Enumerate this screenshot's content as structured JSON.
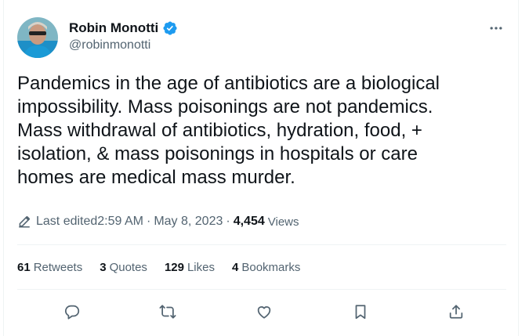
{
  "author": {
    "name": "Robin Monotti",
    "handle": "@robinmonotti",
    "verified": true
  },
  "tweet": {
    "text": "Pandemics in the age of antibiotics are a biological\nimpossibility. Mass poisonings are not pandemics.\nMass withdrawal of antibiotics, hydration, food, +\nisolation, & mass poisonings in hospitals or care\nhomes are medical mass murder."
  },
  "meta": {
    "edited_label": "Last edited",
    "time": "2:59 AM",
    "separator": "·",
    "date": "May 8, 2023",
    "views_count": "4,454",
    "views_label": "Views"
  },
  "stats": {
    "retweets_count": "61",
    "retweets_label": "Retweets",
    "quotes_count": "3",
    "quotes_label": "Quotes",
    "likes_count": "129",
    "likes_label": "Likes",
    "bookmarks_count": "4",
    "bookmarks_label": "Bookmarks"
  },
  "icons": {
    "more": "more-dots-icon",
    "verified": "verified-badge-icon",
    "edit": "pencil-icon",
    "reply": "reply-icon",
    "retweet": "retweet-icon",
    "like": "heart-icon",
    "bookmark": "bookmark-icon",
    "share": "share-icon"
  },
  "colors": {
    "verified_blue": "#1d9bf0",
    "text_primary": "#0f1419",
    "text_secondary": "#536471",
    "divider": "#eff3f4"
  }
}
